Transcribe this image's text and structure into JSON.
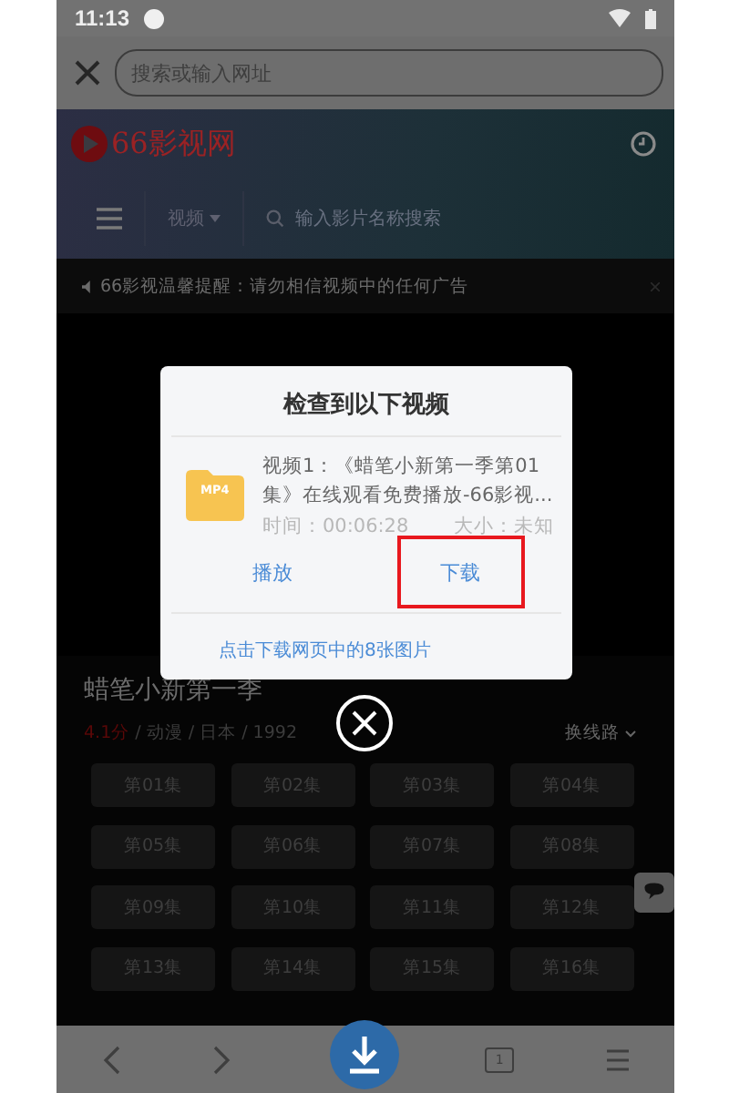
{
  "status_bar": {
    "time": "11:13"
  },
  "browser": {
    "placeholder": "搜索或输入网址"
  },
  "site": {
    "logo": "66影视网",
    "nav_dropdown": "视频",
    "search_placeholder": "输入影片名称搜索"
  },
  "notice": {
    "text": "66影视温馨提醒：请勿相信视频中的任何广告"
  },
  "show": {
    "title": "蜡笔小新第一季",
    "rating": "4.1分",
    "meta": "/ 动漫 / 日本 / 1992",
    "switch_line": "换线路"
  },
  "episodes": [
    "第01集",
    "第02集",
    "第03集",
    "第04集",
    "第05集",
    "第06集",
    "第07集",
    "第08集",
    "第09集",
    "第10集",
    "第11集",
    "第12集",
    "第13集",
    "第14集",
    "第15集",
    "第16集"
  ],
  "dialog": {
    "title": "检查到以下视频",
    "file_type": "MP4",
    "name": "视频1：《蜡笔小新第一季第01集》在线观看免费播放-66影视...",
    "time": "时间：00:06:28",
    "size": "大小：未知",
    "actions": [
      {
        "label": "播放",
        "highlighted": false
      },
      {
        "label": "下载",
        "highlighted": true
      }
    ],
    "footer_link": "点击下载网页中的8张图片"
  },
  "bottom_nav": {
    "tab_count": "1"
  }
}
